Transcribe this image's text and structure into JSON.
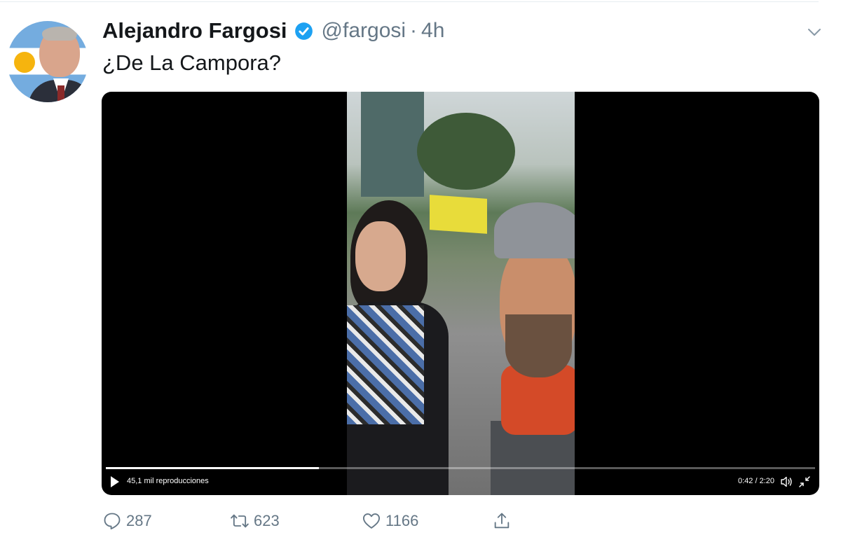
{
  "tweet": {
    "author_name": "Alejandro Fargosi",
    "handle": "@fargosi",
    "separator": "·",
    "time": "4h",
    "text": "¿De La Campora?"
  },
  "video": {
    "views_label": "45,1 mil reproducciones",
    "time_label": "0:42 / 2:20",
    "progress": 0.3
  },
  "actions": {
    "replies": "287",
    "retweets": "623",
    "likes": "1166"
  },
  "icons": {
    "verified": "verified-badge-icon",
    "caret": "chevron-down-icon",
    "play": "play-icon",
    "volume": "volume-icon",
    "exit_fullscreen": "exit-fullscreen-icon",
    "reply": "reply-icon",
    "retweet": "retweet-icon",
    "like": "heart-icon",
    "share": "share-icon"
  },
  "colors": {
    "verified_blue": "#1da1f2",
    "secondary_text": "#657786",
    "primary_text": "#14171a"
  }
}
